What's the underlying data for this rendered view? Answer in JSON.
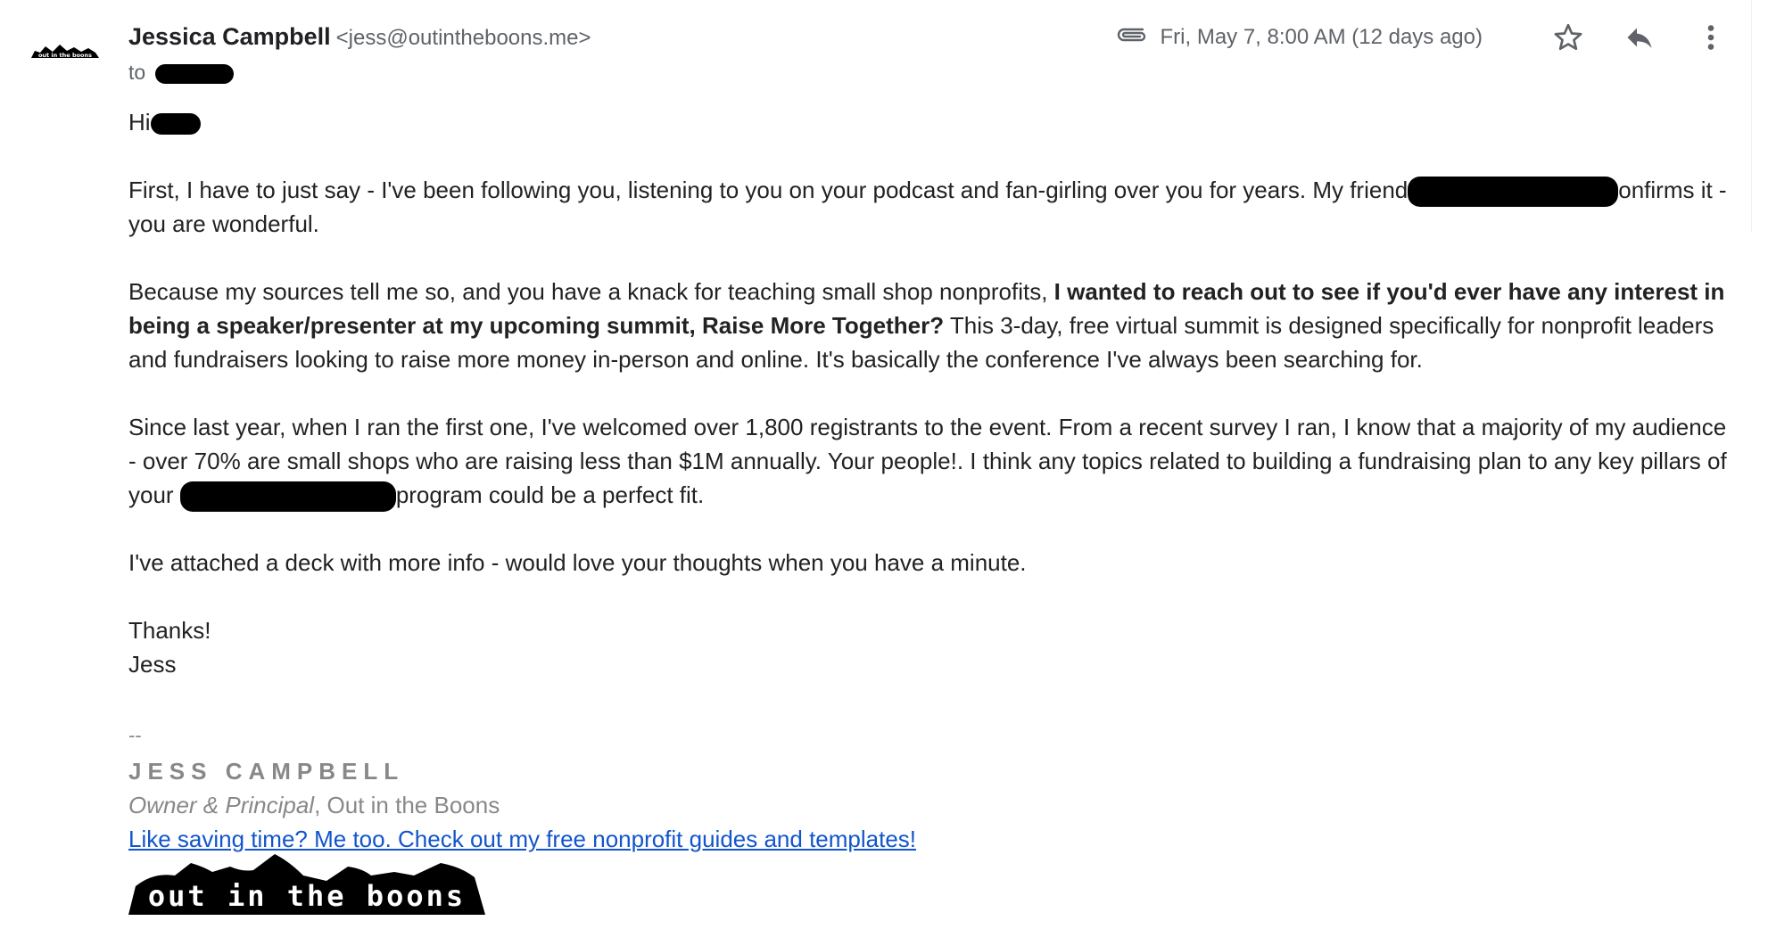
{
  "sender": {
    "name": "Jessica Campbell",
    "email": "<jess@outintheboons.me>"
  },
  "recipient": {
    "prefix": "to"
  },
  "meta": {
    "date": "Fri, May 7, 8:00 AM (12 days ago)"
  },
  "icons": {
    "attachment": "paperclip-icon",
    "star": "star-icon",
    "reply": "reply-icon",
    "more": "more-vert-icon",
    "avatar": "out-in-the-boons-logo"
  },
  "body": {
    "greeting": "Hi",
    "p1": {
      "a": "First, I have to just say - I've been following you, listening to you on your podcast and fan-girling over you for years. My friend",
      "b": "onfirms it - you are wonderful."
    },
    "p2": {
      "a": "Because my sources tell me so, and you have a knack for teaching small shop nonprofits,",
      "bold": "I wanted to reach out to see if you'd ever have any interest in being a speaker/presenter at my upcoming summit, Raise More Together?",
      "c": "This 3-day, free virtual summit is designed specifically for nonprofit leaders and fundraisers looking to raise more money in-person and online. It's basically the conference I've always been searching for."
    },
    "p3": {
      "a": "Since last year, when I ran the first one, I've welcomed over 1,800 registrants to the event. From a recent survey I ran, I know that a majority of my audience - over 70% are small shops who are raising less than $1M annually. Your people!. I think any topics related to building a fundraising plan to any key pillars of your",
      "b": "program could be a perfect fit."
    },
    "p4": "I've attached a deck with more info - would love your thoughts when you have a minute.",
    "closing": "Thanks!",
    "closing_name": "Jess"
  },
  "signature": {
    "dash": "--",
    "name": "JESS CAMPBELL",
    "role": "Owner & Principal",
    "org": ", Out in the Boons",
    "link": "Like saving time? Me too. Check out my free nonprofit guides and templates!",
    "logo_text": "out in the boons"
  }
}
